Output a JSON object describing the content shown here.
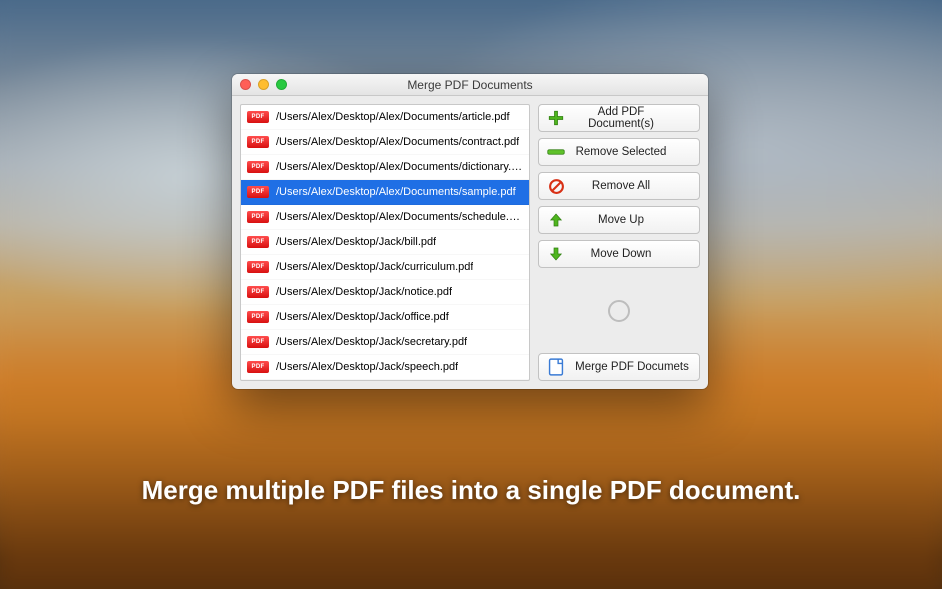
{
  "window": {
    "title": "Merge PDF Documents"
  },
  "files": [
    {
      "path": "/Users/Alex/Desktop/Alex/Documents/article.pdf",
      "selected": false
    },
    {
      "path": "/Users/Alex/Desktop/Alex/Documents/contract.pdf",
      "selected": false
    },
    {
      "path": "/Users/Alex/Desktop/Alex/Documents/dictionary.pdf",
      "selected": false
    },
    {
      "path": "/Users/Alex/Desktop/Alex/Documents/sample.pdf",
      "selected": true
    },
    {
      "path": "/Users/Alex/Desktop/Alex/Documents/schedule.pdf",
      "selected": false
    },
    {
      "path": "/Users/Alex/Desktop/Jack/bill.pdf",
      "selected": false
    },
    {
      "path": "/Users/Alex/Desktop/Jack/curriculum.pdf",
      "selected": false
    },
    {
      "path": "/Users/Alex/Desktop/Jack/notice.pdf",
      "selected": false
    },
    {
      "path": "/Users/Alex/Desktop/Jack/office.pdf",
      "selected": false
    },
    {
      "path": "/Users/Alex/Desktop/Jack/secretary.pdf",
      "selected": false
    },
    {
      "path": "/Users/Alex/Desktop/Jack/speech.pdf",
      "selected": false
    }
  ],
  "buttons": {
    "add": "Add PDF Document(s)",
    "remove_selected": "Remove Selected",
    "remove_all": "Remove All",
    "move_up": "Move Up",
    "move_down": "Move Down",
    "merge": "Merge PDF Documets"
  },
  "pdf_badge_text": "PDF",
  "tagline": "Merge multiple PDF files into a single PDF document."
}
